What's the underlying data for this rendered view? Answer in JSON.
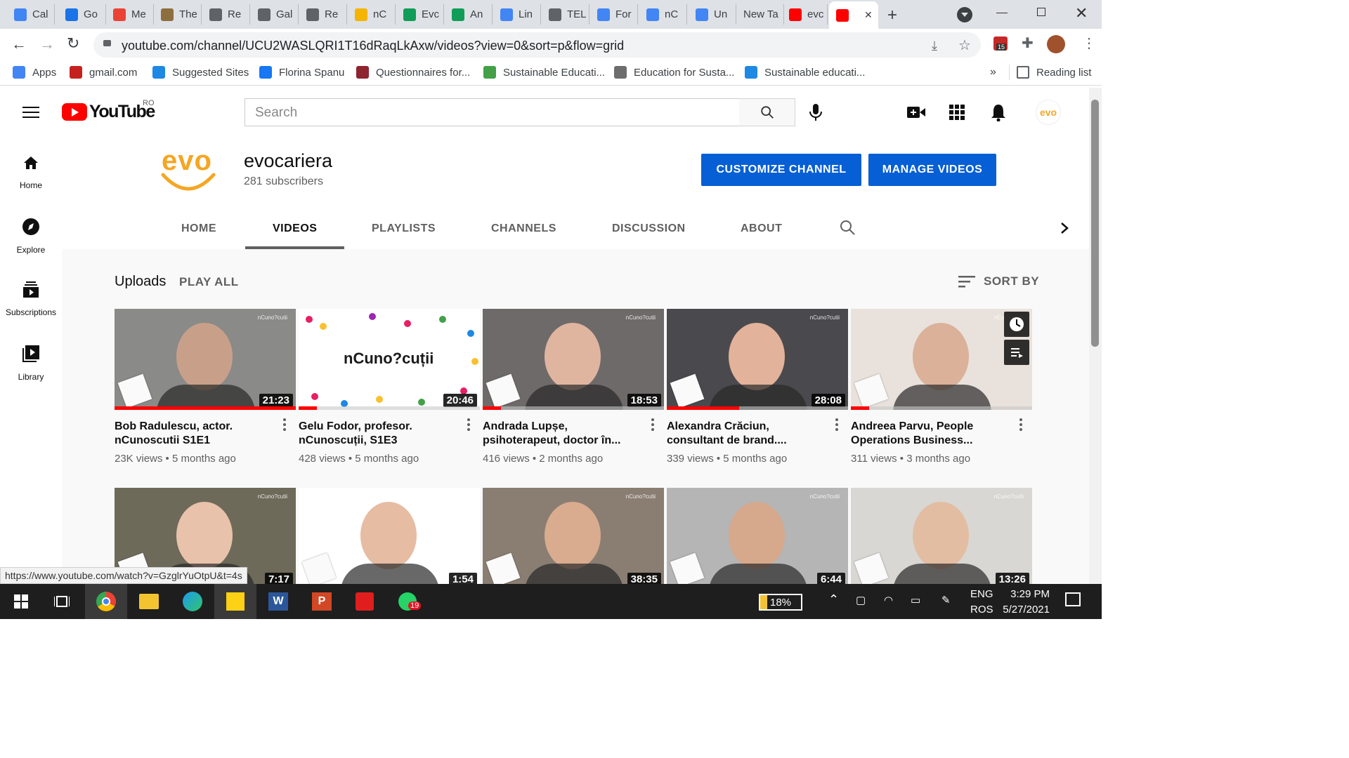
{
  "browser": {
    "tabs": [
      {
        "label": "Cal",
        "color": "#4285f4"
      },
      {
        "label": "Go",
        "color": "#1a73e8"
      },
      {
        "label": "Me",
        "color": "#ea4335"
      },
      {
        "label": "The",
        "color": "#8d6e3f"
      },
      {
        "label": "Re",
        "color": "#5f6368"
      },
      {
        "label": "Gal",
        "color": "#5f6368"
      },
      {
        "label": "Re",
        "color": "#5f6368"
      },
      {
        "label": "nC",
        "color": "#f4b400"
      },
      {
        "label": "Evc",
        "color": "#0f9d58"
      },
      {
        "label": "An",
        "color": "#0f9d58"
      },
      {
        "label": "Lin",
        "color": "#4285f4"
      },
      {
        "label": "TEL",
        "color": "#5f6368"
      },
      {
        "label": "For",
        "color": "#4285f4"
      },
      {
        "label": "nC",
        "color": "#4285f4"
      },
      {
        "label": "Un",
        "color": "#4285f4"
      },
      {
        "label": "New Ta",
        "color": ""
      },
      {
        "label": "evc",
        "color": "#ff0000"
      }
    ],
    "url": "youtube.com/channel/UCU2WASLQRI1T16dRaqLkAxw/videos?view=0&sort=p&flow=grid",
    "extension_badge": "15",
    "bookmarks": [
      {
        "label": "Apps",
        "color": "#4285f4"
      },
      {
        "label": "gmail.com",
        "color": "#c5221f"
      },
      {
        "label": "Suggested Sites",
        "color": "#1e88e5"
      },
      {
        "label": "Florina Spanu",
        "color": "#1877f2"
      },
      {
        "label": "Questionnaires for...",
        "color": "#8e2430"
      },
      {
        "label": "Sustainable Educati...",
        "color": "#43a047"
      },
      {
        "label": "Education for Susta...",
        "color": "#6d6d6d"
      },
      {
        "label": "Sustainable educati...",
        "color": "#1e88e5"
      }
    ],
    "bookmarks_more": "»",
    "reading_list": "Reading list",
    "status_url": "https://www.youtube.com/watch?v=GzglrYuOtpU&t=4s"
  },
  "youtube": {
    "logo_text": "YouTube",
    "country_code": "RO",
    "search_placeholder": "Search",
    "guide": [
      {
        "label": "Home",
        "icon": "home-icon"
      },
      {
        "label": "Explore",
        "icon": "compass-icon"
      },
      {
        "label": "Subscriptions",
        "icon": "subscriptions-icon"
      },
      {
        "label": "Library",
        "icon": "library-icon"
      }
    ],
    "avatar_text": "evo",
    "channel": {
      "logo_text": "evo",
      "name": "evocariera",
      "subscribers": "281 subscribers",
      "customize_label": "CUSTOMIZE CHANNEL",
      "manage_label": "MANAGE VIDEOS",
      "tabs": [
        "HOME",
        "VIDEOS",
        "PLAYLISTS",
        "CHANNELS",
        "DISCUSSION",
        "ABOUT"
      ],
      "selected_tab": "VIDEOS"
    },
    "uploads_label": "Uploads",
    "play_all_label": "PLAY ALL",
    "sort_label": "SORT BY",
    "watermark": "nCuno?cutii",
    "thumb_card_text": "nCuno?cuții",
    "videos_row1": [
      {
        "title1": "Bob Radulescu, actor.",
        "title2": "nCunoscutii S1E1",
        "views": "23K views",
        "age": "5 months ago",
        "duration": "21:23",
        "progress": 1.0,
        "bg": "#8a8a88",
        "face": "#c8a08a"
      },
      {
        "title1": "Gelu Fodor, profesor.",
        "title2": "nCunoscuții, S1E3",
        "views": "428 views",
        "age": "5 months ago",
        "duration": "20:46",
        "progress": 0.1,
        "bg": "#ffffff",
        "face": ""
      },
      {
        "title1": "Andrada Lupșe,",
        "title2": "psihoterapeut, doctor în...",
        "views": "416 views",
        "age": "2 months ago",
        "duration": "18:53",
        "progress": 0.1,
        "bg": "#6f6a6a",
        "face": "#e0b5a0"
      },
      {
        "title1": "Alexandra Crăciun,",
        "title2": "consultant de brand....",
        "views": "339 views",
        "age": "5 months ago",
        "duration": "28:08",
        "progress": 0.4,
        "bg": "#4a4a4e",
        "face": "#e2b29a"
      },
      {
        "title1": "Andreea Parvu, People",
        "title2": "Operations Business...",
        "views": "311 views",
        "age": "3 months ago",
        "duration": "",
        "progress": 0.1,
        "bg": "#e9e2dc",
        "face": "#dbb19a"
      }
    ],
    "videos_row2": [
      {
        "duration": "7:17",
        "bg": "#6e6a5a",
        "face": "#e8c2aa"
      },
      {
        "duration": "1:54",
        "bg": "#ffffff",
        "face": "#e6bca3"
      },
      {
        "duration": "38:35",
        "bg": "#8a7e72",
        "face": "#d9ab8f"
      },
      {
        "duration": "6:44",
        "bg": "#b5b5b5",
        "face": "#d6a88c"
      },
      {
        "duration": "13:26",
        "bg": "#d9d7d3",
        "face": "#e3bda2"
      }
    ]
  },
  "taskbar": {
    "battery": "18%",
    "lang1": "ENG",
    "lang2": "ROS",
    "time": "3:29 PM",
    "date": "5/27/2021",
    "whatsapp_badge": "19"
  }
}
